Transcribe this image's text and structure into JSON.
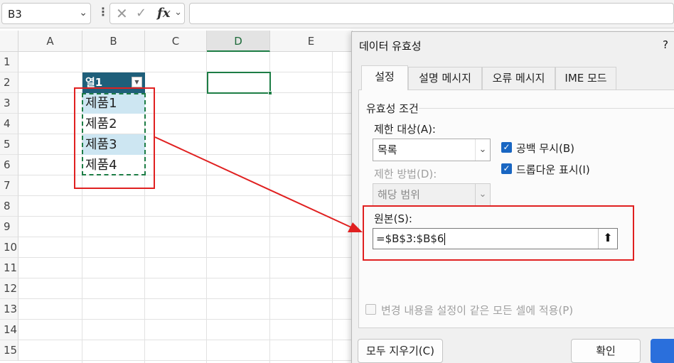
{
  "formula_bar": {
    "name_box": "B3",
    "formula": ""
  },
  "grid": {
    "columns": [
      "A",
      "B",
      "C",
      "D",
      "E"
    ],
    "selected_column": "D",
    "rows": [
      "1",
      "2",
      "3",
      "4",
      "5",
      "6",
      "7",
      "8",
      "9",
      "10",
      "11",
      "12",
      "13",
      "14",
      "15"
    ],
    "table_header": "열1",
    "cells": [
      "제품1",
      "제품2",
      "제품3",
      "제품4"
    ]
  },
  "dialog": {
    "title": "데이터 유효성",
    "help": "?",
    "tabs": [
      "설정",
      "설명 메시지",
      "오류 메시지",
      "IME 모드"
    ],
    "group_label": "유효성 조건",
    "allow_label": "제한 대상(A):",
    "allow_value": "목록",
    "data_label": "제한 방법(D):",
    "data_value": "해당 범위",
    "ignore_blank_label": "공백 무시(B)",
    "in_cell_dropdown_label": "드롭다운 표시(I)",
    "source_label": "원본(S):",
    "source_value": "=$B$3:$B$6",
    "apply_all_label": "변경 내용을 설정이 같은 모든 셀에 적용(P)",
    "clear_all_button": "모두 지우기(C)",
    "ok_button": "확인"
  },
  "colors": {
    "accent": "#1d7d45",
    "table_header": "#1f5f7a",
    "band": "#cde6f2",
    "annotation": "#e02020",
    "checkbox": "#1966c2",
    "primary_button": "#2a6fdc"
  }
}
